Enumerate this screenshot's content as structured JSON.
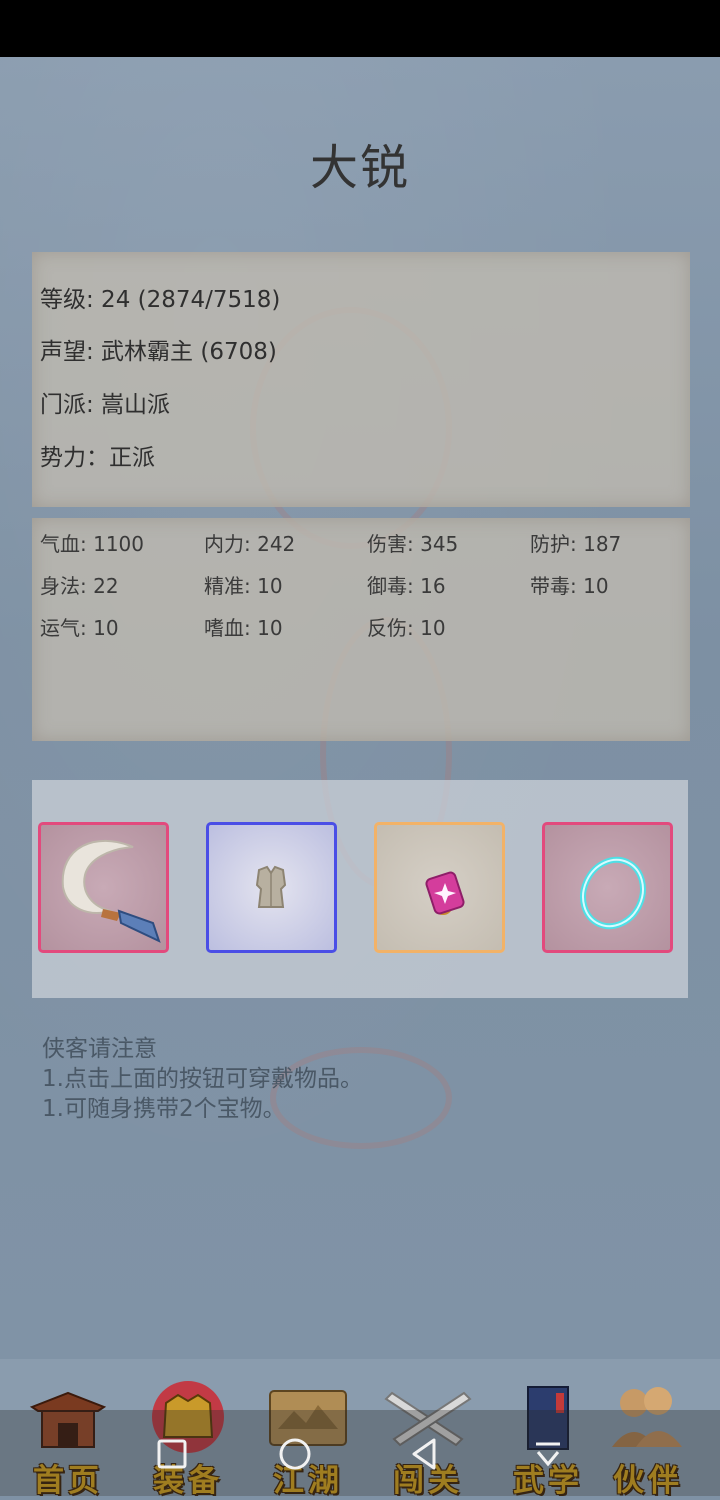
{
  "title": "大锐",
  "info": {
    "level": "等级: 24 (2874/7518)",
    "reputation": "声望: 武林霸主 (6708)",
    "sect": "门派: 嵩山派",
    "faction": "势力：正派"
  },
  "stats": [
    [
      "气血: 1100",
      "内力: 242",
      "伤害: 345",
      "防护: 187"
    ],
    [
      "身法: 22",
      "精准: 10",
      "御毒: 16",
      "带毒: 10"
    ],
    [
      "运气: 10",
      "嗜血: 10",
      "反伤: 10"
    ]
  ],
  "equipment": [
    {
      "icon": "curved-blade-icon",
      "border": "#e24a7d",
      "bg": "#b79aa7"
    },
    {
      "icon": "armor-vest-icon",
      "border": "#4a4ee6",
      "bg": "#c4c6e4"
    },
    {
      "icon": "gem-ring-icon",
      "border": "#f2b267",
      "bg": "#c8c1b6"
    },
    {
      "icon": "jade-bracelet-icon",
      "border": "#e24a7d",
      "bg": "#b79aa7"
    }
  ],
  "notice": {
    "heading": "侠客请注意",
    "line1": "1.点击上面的按钮可穿戴物品。",
    "line2": "1.可随身携带2个宝物。"
  },
  "nav": [
    {
      "label": "首页",
      "icon": "pavilion-icon"
    },
    {
      "label": "装备",
      "icon": "golden-armor-icon"
    },
    {
      "label": "江湖",
      "icon": "scroll-map-icon"
    },
    {
      "label": "闯关",
      "icon": "crossed-swords-icon"
    },
    {
      "label": "武学",
      "icon": "martial-book-icon"
    },
    {
      "label": "伙伴",
      "icon": "companions-icon"
    }
  ],
  "colors": {
    "background": "#8093a6",
    "panel": "#bebab0",
    "nav_text": "#d8a51c",
    "rare_border": "#e24a7d",
    "blue_border": "#4a4ee6",
    "gold_border": "#f2b267"
  }
}
